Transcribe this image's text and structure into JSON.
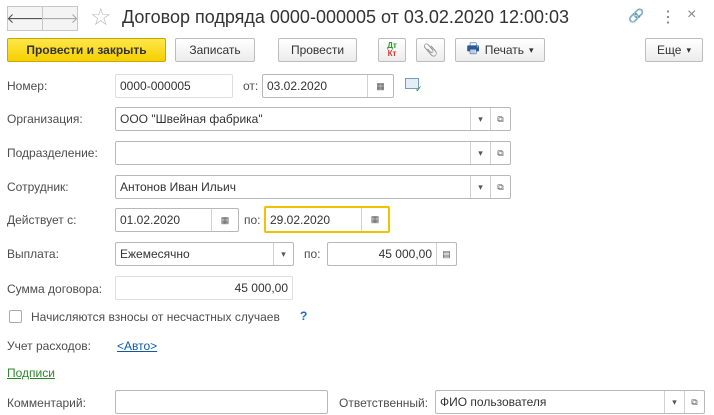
{
  "header": {
    "title": "Договор подряда 0000-000005 от 03.02.2020 12:00:03",
    "back": "🡐",
    "forward": "🡒",
    "star": "☆",
    "link_icon": "🔗",
    "more_icon": "⋮",
    "close_icon": "×"
  },
  "toolbar": {
    "post_close": "Провести и закрыть",
    "save": "Записать",
    "post": "Провести",
    "dt": "Дт",
    "kt": "Кт",
    "clip": "📎",
    "print": "Печать",
    "more": "Еще",
    "arrow": "▾",
    "printer": "🖶"
  },
  "form": {
    "number_label": "Номер:",
    "number": "0000-000005",
    "from_label": "от:",
    "date": "03.02.2020",
    "org_label": "Организация:",
    "org": "ООО \"Швейная фабрика\"",
    "dept_label": "Подразделение:",
    "dept": "",
    "emp_label": "Сотрудник:",
    "emp": "Антонов Иван Ильич",
    "valid_label": "Действует с:",
    "valid_from": "01.02.2020",
    "to_label": "по:",
    "valid_to": "29.02.2020",
    "pay_label": "Выплата:",
    "pay": "Ежемесячно",
    "pay_to_label": "по:",
    "pay_amount": "45 000,00",
    "sum_label": "Сумма договора:",
    "sum": "45 000,00",
    "accident_label": "Начисляются взносы от несчастных случаев",
    "help": "?",
    "cost_label": "Учет расходов:",
    "cost": "<Авто>",
    "signatures": "Подписи",
    "comment_label": "Комментарий:",
    "comment": "",
    "resp_label": "Ответственный:",
    "resp": "ФИО пользователя"
  },
  "icons": {
    "dropdown": "▾",
    "open": "⧉",
    "calendar": "▦",
    "calc": "▤"
  }
}
